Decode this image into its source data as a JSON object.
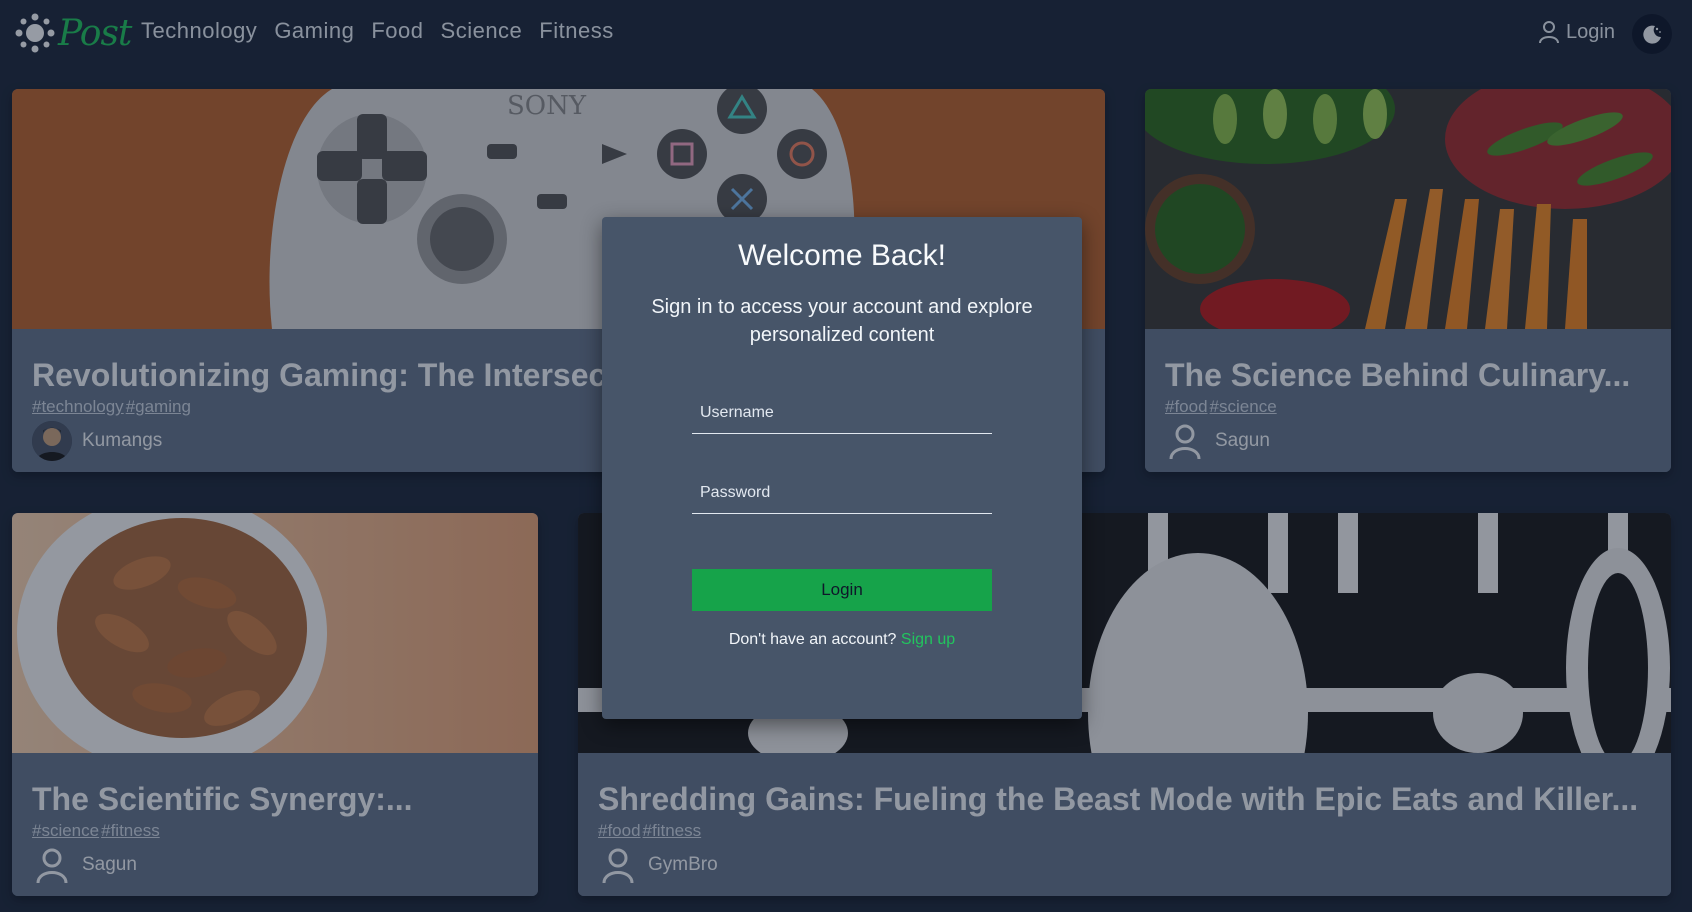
{
  "brand": {
    "logo_text": "Post"
  },
  "nav": {
    "items": [
      "Technology",
      "Gaming",
      "Food",
      "Science",
      "Fitness"
    ]
  },
  "header": {
    "login_label": "Login"
  },
  "cards": [
    {
      "title": "Revolutionizing Gaming: The Intersection...",
      "tags": [
        "#technology",
        "#gaming"
      ],
      "author": "Kumangs"
    },
    {
      "title": "The Science Behind Culinary...",
      "tags": [
        "#food",
        "#science"
      ],
      "author": "Sagun"
    },
    {
      "title": "The Scientific Synergy:...",
      "tags": [
        "#science",
        "#fitness"
      ],
      "author": "Sagun"
    },
    {
      "title": "Shredding Gains: Fueling the Beast Mode with Epic Eats and Killer...",
      "tags": [
        "#food",
        "#fitness"
      ],
      "author": "GymBro"
    }
  ],
  "modal": {
    "title": "Welcome Back!",
    "subtitle": "Sign in to access your account and explore personalized content",
    "username_placeholder": "Username",
    "password_placeholder": "Password",
    "login_button": "Login",
    "signup_prompt": "Don't have an account?",
    "signup_link": "Sign up"
  },
  "colors": {
    "accent": "#22c55e",
    "button": "#16a34a",
    "background": "#1e293b",
    "card": "#64748b"
  }
}
